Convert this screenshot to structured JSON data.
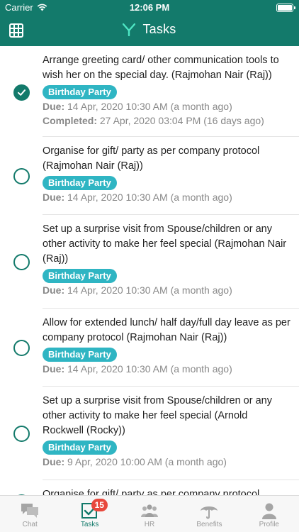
{
  "status_bar": {
    "carrier": "Carrier",
    "time": "12:06 PM"
  },
  "nav": {
    "title": "Tasks"
  },
  "tasks": [
    {
      "text": "Arrange greeting card/ other communication tools to wish her on the special day. (Rajmohan Nair (Raj))",
      "tag": "Birthday Party",
      "due_label": "Due:",
      "due": "14 Apr, 2020 10:30 AM (a month ago)",
      "completed_label": "Completed:",
      "completed": "27 Apr, 2020 03:04 PM (16 days ago)",
      "done": true
    },
    {
      "text": "Organise for gift/ party as per company protocol (Rajmohan Nair (Raj))",
      "tag": "Birthday Party",
      "due_label": "Due:",
      "due": "14 Apr, 2020 10:30 AM (a month ago)",
      "done": false
    },
    {
      "text": "Set up a surprise visit from Spouse/children or any other activity to make her feel special (Rajmohan Nair (Raj))",
      "tag": "Birthday Party",
      "due_label": "Due:",
      "due": "14 Apr, 2020 10:30 AM (a month ago)",
      "done": false
    },
    {
      "text": "Allow for extended lunch/ half day/full day leave as per company protocol (Rajmohan Nair (Raj))",
      "tag": "Birthday Party",
      "due_label": "Due:",
      "due": "14 Apr, 2020 10:30 AM (a month ago)",
      "done": false
    },
    {
      "text": "Set up a surprise visit from Spouse/children or any other activity to make her feel special (Arnold Rockwell (Rocky))",
      "tag": "Birthday Party",
      "due_label": "Due:",
      "due": "9 Apr, 2020 10:00 AM (a month ago)",
      "done": false
    },
    {
      "text": "Organise for gift/ party as per company protocol",
      "done": false
    }
  ],
  "tabs": [
    {
      "label": "Chat",
      "icon": "chat-icon"
    },
    {
      "label": "Tasks",
      "icon": "tasks-icon",
      "badge": "15",
      "active": true
    },
    {
      "label": "HR",
      "icon": "hr-people-icon"
    },
    {
      "label": "Benefits",
      "icon": "umbrella-icon"
    },
    {
      "label": "Profile",
      "icon": "profile-icon"
    }
  ],
  "colors": {
    "brand": "#137a6b",
    "tag": "#2fb5c3",
    "badge": "#e8483c"
  }
}
